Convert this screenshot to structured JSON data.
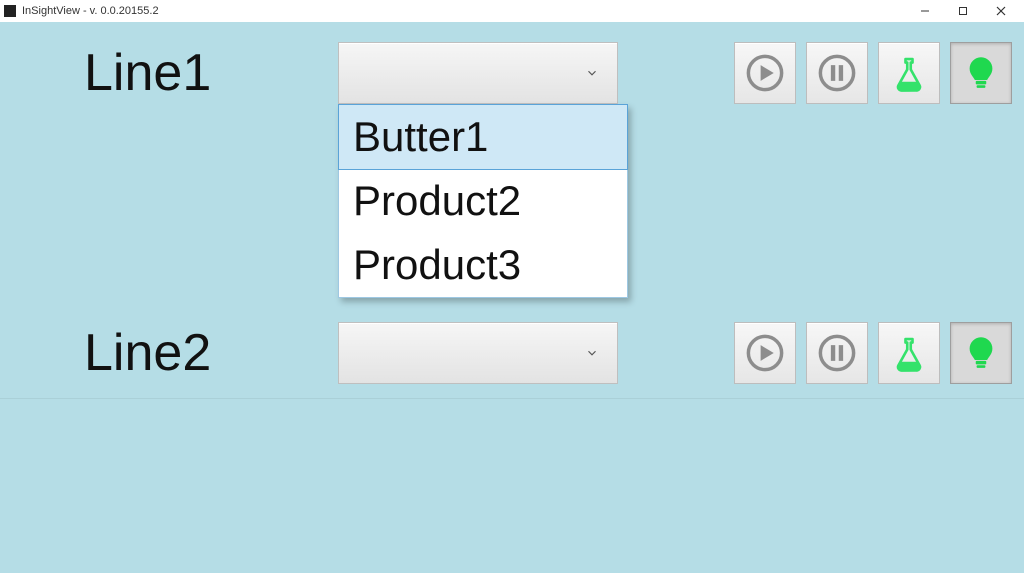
{
  "window": {
    "title": "InSightView - v. 0.0.20155.2"
  },
  "lines": [
    {
      "label": "Line1",
      "selected": "",
      "dropdownOpen": true,
      "options": [
        "Butter1",
        "Product2",
        "Product3"
      ],
      "highlightIndex": 0,
      "bulbActive": true
    },
    {
      "label": "Line2",
      "selected": "",
      "dropdownOpen": false,
      "bulbActive": true
    }
  ],
  "icons": {
    "play": "play-icon",
    "pause": "pause-icon",
    "flask": "flask-icon",
    "bulb": "bulb-icon"
  }
}
